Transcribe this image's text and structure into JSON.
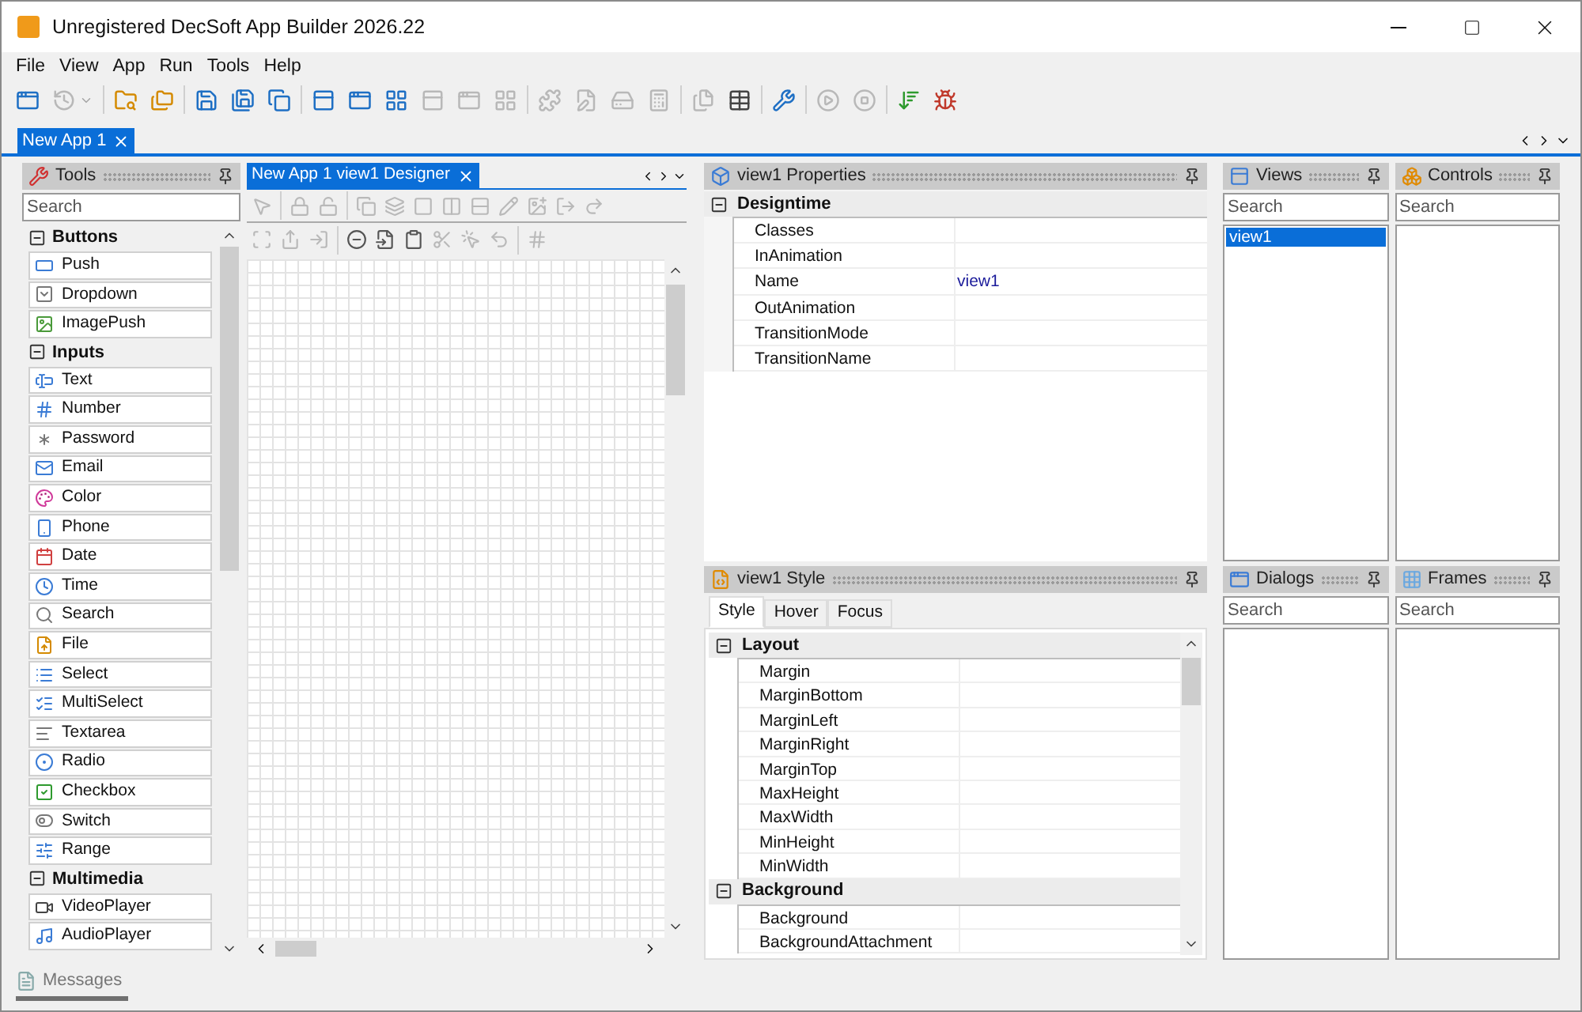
{
  "window": {
    "title": "Unregistered DecSoft App Builder 2026.22"
  },
  "menu": [
    "File",
    "View",
    "App",
    "Run",
    "Tools",
    "Help"
  ],
  "toolbar": [
    [
      {
        "kind": "button",
        "disabled": false
      },
      {
        "kind": "split",
        "disabled": true
      }
    ],
    [
      {
        "kind": "button",
        "disabled": false
      },
      {
        "kind": "button",
        "disabled": false
      }
    ],
    [
      {
        "kind": "button",
        "disabled": false
      },
      {
        "kind": "button",
        "disabled": false
      },
      {
        "kind": "button",
        "disabled": false
      }
    ],
    [
      {
        "kind": "button",
        "disabled": false
      },
      {
        "kind": "button",
        "disabled": false
      },
      {
        "kind": "button",
        "disabled": false
      },
      {
        "kind": "button",
        "disabled": true
      },
      {
        "kind": "button",
        "disabled": true
      },
      {
        "kind": "button",
        "disabled": true
      }
    ],
    [
      {
        "kind": "button",
        "disabled": true
      },
      {
        "kind": "button",
        "disabled": true
      },
      {
        "kind": "button",
        "disabled": true
      },
      {
        "kind": "button",
        "disabled": true
      }
    ],
    [
      {
        "kind": "button",
        "disabled": true
      },
      {
        "kind": "button",
        "disabled": false
      }
    ],
    [
      {
        "kind": "button",
        "disabled": false
      }
    ],
    [
      {
        "kind": "button",
        "disabled": true
      },
      {
        "kind": "button",
        "disabled": true
      }
    ],
    [
      {
        "kind": "button",
        "disabled": false
      },
      {
        "kind": "button",
        "disabled": false
      }
    ]
  ],
  "documents": [
    {
      "label": "New App 1",
      "selected": true
    }
  ],
  "tools": {
    "title": "Tools",
    "search": {
      "placeholder": "Search"
    },
    "groups": [
      {
        "label": "Buttons",
        "expanded": true,
        "items": [
          "Push",
          "Dropdown",
          "ImagePush"
        ]
      },
      {
        "label": "Inputs",
        "expanded": true,
        "items": [
          "Text",
          "Number",
          "Password",
          "Email",
          "Color",
          "Phone",
          "Date",
          "Time",
          "Search",
          "File",
          "Select",
          "MultiSelect",
          "Textarea",
          "Radio",
          "Checkbox",
          "Switch",
          "Range"
        ]
      },
      {
        "label": "Multimedia",
        "expanded": true,
        "items": [
          "VideoPlayer",
          "AudioPlayer"
        ]
      }
    ]
  },
  "designer": {
    "tabs": [
      {
        "label": "New App 1 view1 Designer",
        "selected": true
      }
    ],
    "toolbar_rows": [
      [
        [
          {
            "disabled": true
          }
        ],
        [
          {
            "disabled": true
          },
          {
            "disabled": true
          }
        ],
        [
          {
            "disabled": true
          },
          {
            "disabled": true
          },
          {
            "disabled": true
          },
          {
            "disabled": true
          },
          {
            "disabled": true
          },
          {
            "disabled": true
          },
          {
            "disabled": true
          },
          {
            "disabled": true
          },
          {
            "disabled": true
          }
        ]
      ],
      [
        [
          {
            "disabled": true
          },
          {
            "disabled": true
          },
          {
            "disabled": true
          }
        ],
        [
          {
            "disabled": false
          },
          {
            "disabled": false
          },
          {
            "disabled": false
          },
          {
            "disabled": true
          },
          {
            "disabled": true
          },
          {
            "disabled": true
          }
        ],
        [
          {
            "disabled": true
          }
        ]
      ]
    ]
  },
  "properties": {
    "title": "view1 Properties",
    "groups": [
      {
        "label": "Designtime",
        "expanded": true,
        "rows": [
          {
            "name": "Classes"
          },
          {
            "name": "InAnimation"
          },
          {
            "name": "Name",
            "value": "view1"
          },
          {
            "name": "OutAnimation"
          },
          {
            "name": "TransitionMode"
          },
          {
            "name": "TransitionName"
          }
        ]
      }
    ]
  },
  "style": {
    "title": "view1 Style",
    "tabs": [
      {
        "label": "Style",
        "selected": true
      },
      {
        "label": "Hover",
        "selected": false
      },
      {
        "label": "Focus",
        "selected": false
      }
    ],
    "groups": [
      {
        "label": "Layout",
        "expanded": true,
        "rows": [
          {
            "name": "Margin"
          },
          {
            "name": "MarginBottom"
          },
          {
            "name": "MarginLeft"
          },
          {
            "name": "MarginRight"
          },
          {
            "name": "MarginTop"
          },
          {
            "name": "MaxHeight"
          },
          {
            "name": "MaxWidth"
          },
          {
            "name": "MinHeight"
          },
          {
            "name": "MinWidth"
          }
        ]
      },
      {
        "label": "Background",
        "expanded": true,
        "rows": [
          {
            "name": "Background"
          },
          {
            "name": "BackgroundAttachment"
          }
        ]
      }
    ]
  },
  "views": {
    "title": "Views",
    "search": {
      "placeholder": "Search"
    },
    "items": [
      {
        "label": "view1",
        "selected": true
      }
    ]
  },
  "controls": {
    "title": "Controls",
    "search": {
      "placeholder": "Search"
    }
  },
  "dialogs": {
    "title": "Dialogs",
    "search": {
      "placeholder": "Search"
    }
  },
  "frames": {
    "title": "Frames",
    "search": {
      "placeholder": "Search"
    }
  },
  "status_bar": {
    "messages": "Messages"
  }
}
